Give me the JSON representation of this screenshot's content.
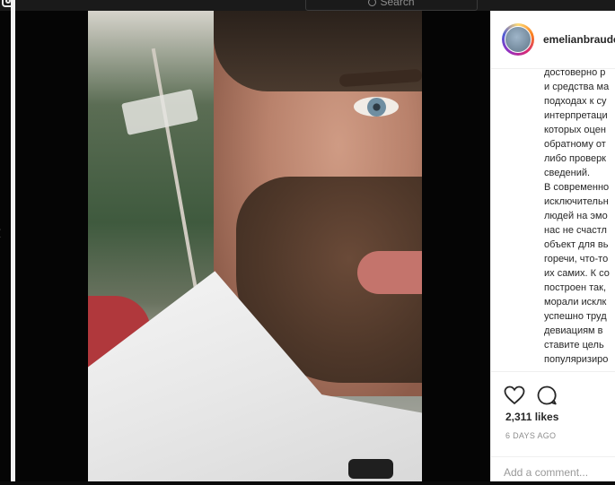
{
  "search": {
    "placeholder": "Search"
  },
  "navigation": {
    "prev_arrow": "‹"
  },
  "post": {
    "username": "emelianbraude",
    "caption_lines": [
      "достоверно р",
      "и средства ма",
      "подходах к су",
      "интерпретаци",
      "которых оцен",
      "обратному от",
      "либо проверк",
      "сведений.",
      "В современно",
      "исключительн",
      "людей на эмо",
      "нас не счастл",
      "объект для вь",
      "горечи, что-то",
      "их самих. К со",
      "построен так,",
      "морали исклк",
      "успешно труд",
      "девиациям в",
      "ставите цель",
      "популяризиро"
    ],
    "likes": "2,311 likes",
    "time": "6 DAYS AGO",
    "add_comment_placeholder": "Add a comment..."
  },
  "icons": {
    "instagram": "instagram-icon",
    "search": "search-icon",
    "like": "heart-icon",
    "comment": "comment-icon",
    "prev": "chevron-left-icon"
  }
}
